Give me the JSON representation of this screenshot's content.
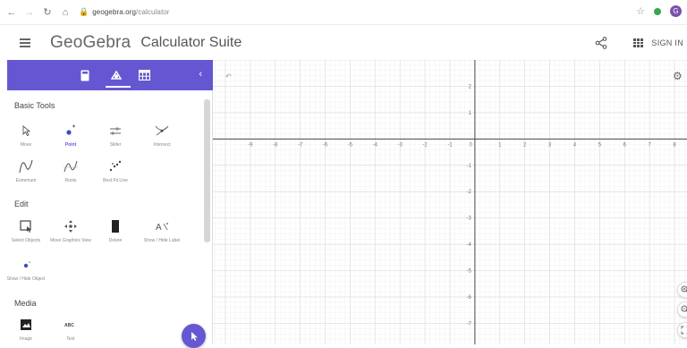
{
  "browser": {
    "url_host": "geogebra.org",
    "url_path": "/calculator"
  },
  "header": {
    "brand": "GeoGebra",
    "suite": "Calculator Suite",
    "sign_in": "SIGN IN"
  },
  "colors": {
    "accent": "#6557d2",
    "grid_minor": "#f0f0f0",
    "grid_major": "#dcdcdc",
    "axis": "#444444"
  },
  "panel": {
    "tabs": [
      {
        "name": "calculator-tab",
        "icon": "calculator-icon"
      },
      {
        "name": "tools-tab",
        "icon": "geometry-tools-icon"
      },
      {
        "name": "table-tab",
        "icon": "table-icon"
      }
    ],
    "sections": {
      "basic": "Basic Tools",
      "edit": "Edit",
      "media": "Media"
    },
    "basic_tools": [
      {
        "label": "Move",
        "icon": "move-arrow-icon"
      },
      {
        "label": "Point",
        "icon": "point-icon"
      },
      {
        "label": "Slider",
        "icon": "slider-icon"
      },
      {
        "label": "Intersect",
        "icon": "intersect-icon"
      },
      {
        "label": "Extremum",
        "icon": "extremum-icon"
      },
      {
        "label": "Roots",
        "icon": "roots-icon"
      },
      {
        "label": "Best Fit Line",
        "icon": "best-fit-line-icon"
      }
    ],
    "edit_tools": [
      {
        "label": "Select Objects",
        "icon": "select-objects-icon"
      },
      {
        "label": "Move Graphics View",
        "icon": "move-graphics-icon"
      },
      {
        "label": "Delete",
        "icon": "delete-icon"
      },
      {
        "label": "Show / Hide Label",
        "icon": "show-hide-label-icon"
      },
      {
        "label": "Show / Hide Object",
        "icon": "show-hide-object-icon"
      }
    ],
    "media_tools": [
      {
        "label": "Image",
        "icon": "image-icon"
      },
      {
        "label": "Text",
        "icon": "text-icon"
      }
    ]
  },
  "graph": {
    "x_ticks": [
      -9,
      -8,
      -7,
      -6,
      -5,
      -4,
      -3,
      -2,
      -1,
      0,
      1,
      2,
      3,
      4,
      5,
      6,
      7,
      8
    ],
    "y_ticks": [
      2,
      1,
      -1,
      -2,
      -3,
      -4,
      -5,
      -6,
      -7
    ],
    "x_range": [
      -10.5,
      8.5
    ],
    "y_range": [
      -7.8,
      3.0
    ]
  }
}
